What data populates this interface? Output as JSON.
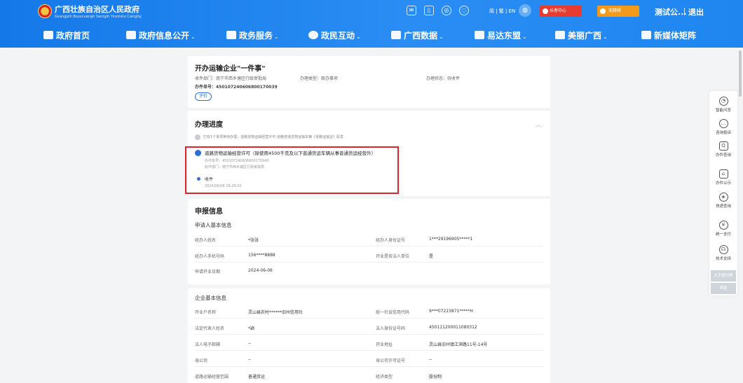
{
  "header": {
    "site_title": "广西壮族自治区人民政府",
    "site_subtitle": "Gvangjsih Bouxcuengh Swcigih Yinzminz Cwngfuj",
    "lang": "简 | 繁 | EN",
    "elder_btn": "长者中心",
    "access_btn": "无障碍",
    "user": "测试公...",
    "logout": "退出"
  },
  "nav": [
    {
      "label": "政府首页"
    },
    {
      "label": "政府信息公开",
      "chev": "⌄"
    },
    {
      "label": "政务服务",
      "chev": "⌄"
    },
    {
      "label": "政民互动",
      "chev": "⌄"
    },
    {
      "label": "广西数据",
      "chev": "⌄"
    },
    {
      "label": "易达东盟",
      "chev": "⌄"
    },
    {
      "label": "美丽广西",
      "chev": "⌄"
    },
    {
      "label": "新媒体矩阵"
    }
  ],
  "summary": {
    "title": "开办运输企业\"一件事\"",
    "dept": "收件部门：南宁市西乡塘区行政审批局",
    "type": "办理类型：联办事项",
    "status": "办理状态：待收件",
    "number": "办件单号：450107240606800170039",
    "eval_btn": "评价"
  },
  "progress": {
    "title": "办理进度",
    "collapse": "︿",
    "hint": "已有1个事项等待办理：道路货物运输经营许可-道路普通货物运输车辆《道路运输证》配发",
    "item_title": "道路货物运输经营许可（除使用4500千克及以下普通货运车辆从事普通货运经营外）",
    "item_number": "办件单号：450107240606800170040",
    "item_dept": "收件部门：南宁市西乡塘区行政审批局",
    "step": "收件",
    "step_time": "2024/06/06 16:29:02"
  },
  "application": {
    "title": "申报信息",
    "applicant_section": "申请人基本信息",
    "applicant_rows": [
      {
        "l1": "经办人姓名",
        "v1": "*张张",
        "l2": "经办人身份证号",
        "v2": "1***29196905*****1"
      },
      {
        "l1": "经办人手机号码",
        "v1": "156****8888",
        "l2": "开业是否法人单位",
        "v2": "是"
      },
      {
        "l1": "申请开业日期",
        "v1": "2024-06-06",
        "l2": "",
        "v2": ""
      }
    ],
    "company_section": "企业基本信息",
    "company_rows": [
      {
        "l1": "开业户名称",
        "v1": "灵山县农村******旧州信用社",
        "l2": "统一社会信用代码",
        "v2": "9***07215871*****H"
      },
      {
        "l1": "法定代表人姓名",
        "v1": "*颖",
        "l2": "法人身份证号码",
        "v2": "450111200011080312"
      },
      {
        "l1": "法人电子邮箱",
        "v1": "--",
        "l2": "开业地址",
        "v2": "灵山县旧州镇江滨路11号-14号"
      },
      {
        "l1": "母公司",
        "v1": "--",
        "l2": "母公司许可证号",
        "v2": "--"
      },
      {
        "l1": "道路运输经营范围",
        "v1": "普通货运",
        "l2": "经济类型",
        "v2": "股份制"
      }
    ]
  },
  "sidebar": {
    "items": [
      {
        "label": "智能问答",
        "icon": "robot-icon",
        "glyph": "◔"
      },
      {
        "label": "咨询投诉",
        "icon": "chat-icon",
        "glyph": "…"
      },
      {
        "label": "办件查询",
        "icon": "search-doc-icon",
        "glyph": "Q"
      },
      {
        "label": "办件公示",
        "icon": "home-icon",
        "glyph": "⌂"
      },
      {
        "label": "快递查询",
        "icon": "box-icon",
        "glyph": "◈"
      },
      {
        "label": "统一支付",
        "icon": "yen-icon",
        "glyph": "¥"
      },
      {
        "label": "技术支持",
        "icon": "headset-icon",
        "glyph": "☊"
      }
    ],
    "btn_top": "大字版切换",
    "btn_help": "帮助"
  }
}
